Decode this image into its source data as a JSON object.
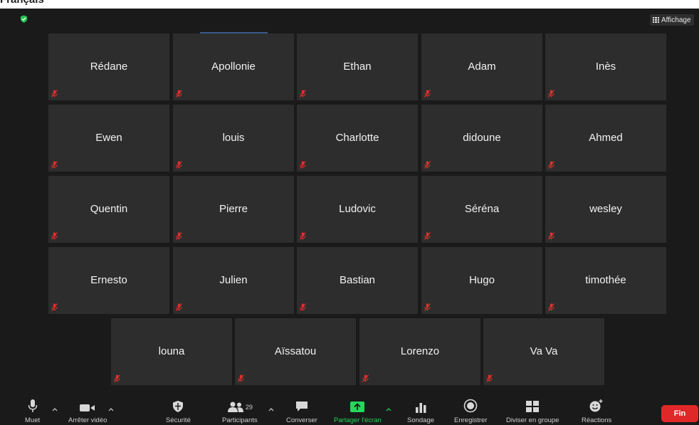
{
  "window": {
    "title": "Français"
  },
  "header": {
    "view_label": "Affichage",
    "security_badge_icon": "shield-check-icon"
  },
  "participants_grid": [
    [
      "Rédane",
      "Apollonie",
      "Ethan",
      "Adam",
      "Inès"
    ],
    [
      "Ewen",
      "louis",
      "Charlotte",
      "didoune",
      "Ahmed"
    ],
    [
      "Quentin",
      "Pierre",
      "Ludovic",
      "Séréna",
      "wesley"
    ],
    [
      "Ernesto",
      "Julien",
      "Bastian",
      "Hugo",
      "timothée"
    ],
    [
      "louna",
      "Aïssatou",
      "Lorenzo",
      "Va Va"
    ]
  ],
  "toolbar": {
    "mute": "Muet",
    "stop_video": "Arrêter vidéo",
    "security": "Sécurité",
    "participants": "Participants",
    "participants_count": "29",
    "chat": "Converser",
    "share_screen": "Partager l'écran",
    "poll": "Sondage",
    "record": "Enregistrer",
    "breakout": "Diviser en groupe",
    "reactions": "Réactions",
    "end": "Fin"
  },
  "colors": {
    "background": "#1a1a1a",
    "tile": "#2d2d2d",
    "muted_icon": "#e0312c",
    "share_green": "#23d959",
    "end_red": "#e02828",
    "security_green": "#23c552"
  }
}
